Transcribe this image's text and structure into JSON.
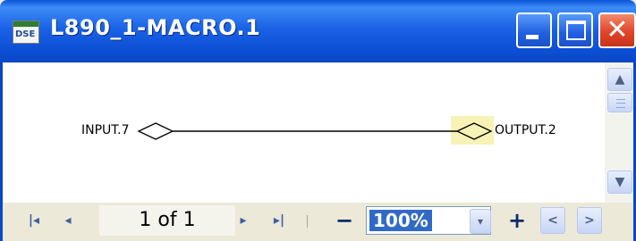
{
  "window": {
    "app_icon_text": "DSE",
    "title": "L890_1-MACRO.1",
    "minimize_glyph": "_",
    "maximize_glyph": "□",
    "close_glyph": "✕"
  },
  "diagram": {
    "input_label": "INPUT.7",
    "output_label": "OUTPUT.2",
    "connector_color": "#000000",
    "output_highlight_color": "#f7f2b5"
  },
  "scrollbar": {
    "up_glyph": "▲",
    "down_glyph": "▼"
  },
  "toolbar": {
    "first_glyph": "|◂",
    "prev_glyph": "◂",
    "page_text": "1 of 1",
    "next_glyph": "▸",
    "last_glyph": "▸|",
    "zoom_out_glyph": "−",
    "zoom_value": "100%",
    "zoom_dropdown_glyph": "▾",
    "zoom_in_glyph": "+",
    "scroll_left_glyph": "<",
    "scroll_right_glyph": ">"
  },
  "colors": {
    "titlebar_blue": "#0a55d8",
    "close_red": "#e1452a",
    "selection_blue": "#316ac5"
  }
}
